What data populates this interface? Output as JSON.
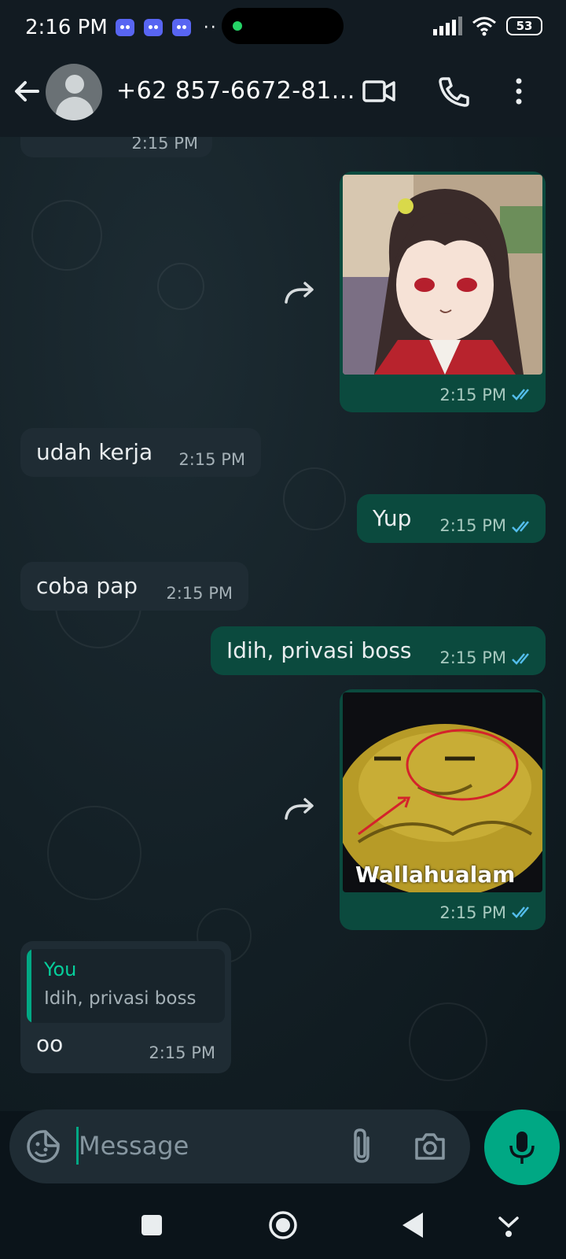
{
  "status_bar": {
    "time": "2:16 PM",
    "battery": "53"
  },
  "header": {
    "contact": "+62 857-6672-81..."
  },
  "messages": [
    {
      "text": "",
      "time": "2:15 PM"
    },
    {
      "type": "image_out",
      "time": "2:15 PM"
    },
    {
      "text": "udah kerja",
      "time": "2:15 PM"
    },
    {
      "text": "Yup",
      "time": "2:15 PM"
    },
    {
      "text": "coba pap",
      "time": "2:15 PM"
    },
    {
      "text": "Idih, privasi boss",
      "time": "2:15 PM"
    },
    {
      "type": "image_out",
      "caption": "Wallahualam",
      "time": "2:15 PM"
    },
    {
      "quote_author": "You",
      "quote_text": "Idih, privasi boss",
      "text": "oo",
      "time": "2:15 PM"
    }
  ],
  "composer": {
    "placeholder": "Message"
  },
  "colors": {
    "accent": "#00a884",
    "outgoing": "#005c4b",
    "incoming": "#1f2c34",
    "tick_read": "#53bdeb"
  }
}
